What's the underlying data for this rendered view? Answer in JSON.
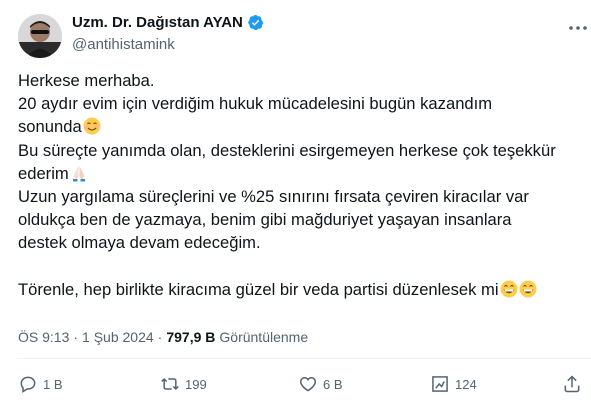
{
  "author": {
    "name": "Uzm. Dr. Dağıstan AYAN",
    "handle": "@antihistamink",
    "verified_color": "#1d9bf0"
  },
  "tweet": {
    "lines": [
      "Herkese merhaba.",
      "20 aydır evim için verdiğim hukuk mücadelesini bugün kazandım",
      "sonunda",
      "Bu süreçte yanımda olan, desteklerini esirgemeyen herkese çok teşekkür",
      "ederim",
      "Uzun yargılama süreçlerini ve %25 sınırını fırsata çeviren kiracılar var",
      "oldukça ben de yazmaya, benim gibi mağduriyet yaşayan insanlara",
      "destek olmaya devam edeceğim.",
      "Törenle, hep birlikte kiracıma güzel bir veda partisi düzenlesek mi"
    ],
    "emojis": [
      "smiling-face-emoji",
      "folded-hands-emoji",
      "grinning-face-emoji"
    ]
  },
  "meta": {
    "time": "ÖS 9:13",
    "sep": "·",
    "date": "1 Şub 2024",
    "views_count": "797,9 B",
    "views_label": "Görüntülenme"
  },
  "actions": {
    "reply": "1 B",
    "retweet": "199",
    "like": "6 B",
    "bookmark": "124"
  },
  "icons": [
    "verified-badge-icon",
    "more-icon",
    "reply-icon",
    "retweet-icon",
    "like-icon",
    "bookmark-icon",
    "share-icon"
  ],
  "colors": {
    "text": "#0f1419",
    "secondary": "#536471",
    "accent": "#1d9bf0"
  }
}
